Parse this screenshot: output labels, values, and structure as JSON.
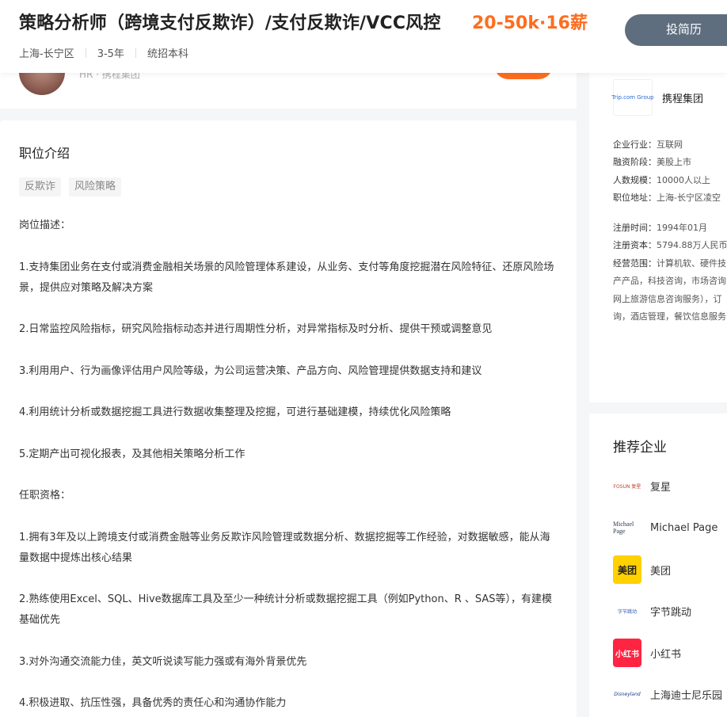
{
  "header": {
    "job_title": "策略分析师（跨境支付反欺诈）/支付反欺诈/VCC风控",
    "salary": "20-50k·16薪",
    "location": "上海-长宁区",
    "experience": "3-5年",
    "education": "统招本科",
    "apply_label": "投简历"
  },
  "recruiter": {
    "text": "HR · 携程集团"
  },
  "job": {
    "section_title": "职位介绍",
    "tags": [
      "反欺诈",
      "风险策略"
    ],
    "description": [
      "岗位描述：",
      "1.支持集团业务在支付或消费金融相关场景的风险管理体系建设，从业务、支付等角度挖掘潜在风险特征、还原风险场景，提供应对策略及解决方案",
      "2.日常监控风险指标，研究风险指标动态并进行周期性分析，对异常指标及时分析、提供干预或调整意见",
      "3.利用用户、行为画像评估用户风险等级，为公司运营决策、产品方向、风险管理提供数据支持和建议",
      "4.利用统计分析或数据挖掘工具进行数据收集整理及挖掘，可进行基础建模，持续优化风险策略",
      "5.定期产出可视化报表，及其他相关策略分析工作",
      "任职资格：",
      "1.拥有3年及以上跨境支付或消费金融等业务反欺诈风险管理或数据分析、数据挖掘等工作经验，对数据敏感，能从海量数据中提炼出核心结果",
      "2.熟练使用Excel、SQL、Hive数据库工具及至少一种统计分析或数据挖掘工具（例如Python、R 、SAS等），有建模基础优先",
      "3.对外沟通交流能力佳，英文听说读写能力强或有海外背景优先",
      "4.积极进取、抗压性强，具备优秀的责任心和沟通协作能力"
    ]
  },
  "company": {
    "logo_text": "Trip.com Group",
    "name": "携程集团",
    "industry_label": "企业行业：",
    "industry": "互联网",
    "stage_label": "融资阶段：",
    "stage": "美股上市",
    "size_label": "人数规模：",
    "size": "10000人以上",
    "address_label": "职位地址：",
    "address": "上海-长宁区凌空",
    "reg_time_label": "注册时间：",
    "reg_time": "1994年01月",
    "capital_label": "注册资本：",
    "capital": "5794.88万人民币",
    "scope_label": "经营范围：",
    "scope_lines": [
      "计算机软、硬件技",
      "产产品，科技咨询，市场咨询",
      "网上旅游信息咨询服务），订",
      "询，酒店管理，餐饮信息服务"
    ]
  },
  "recommend": {
    "title": "推荐企业",
    "items": [
      {
        "name": "复星",
        "logo_text": "FOSUN 复星",
        "logo_color": "#b8432f",
        "logo_bg": "#ffffff"
      },
      {
        "name": "Michael Page",
        "logo_text": "Michael Page",
        "logo_color": "#2b3a55",
        "logo_bg": "#ffffff"
      },
      {
        "name": "美团",
        "logo_text": "美团",
        "logo_color": "#222222",
        "logo_bg": "#ffd100"
      },
      {
        "name": "字节跳动",
        "logo_text": "字节跳动",
        "logo_color": "#325ab4",
        "logo_bg": "#ffffff"
      },
      {
        "name": "小红书",
        "logo_text": "小红书",
        "logo_color": "#ffffff",
        "logo_bg": "#ff2442"
      },
      {
        "name": "上海迪士尼乐园",
        "logo_text": "Disneyland",
        "logo_color": "#1d3c8f",
        "logo_bg": "#ffffff"
      }
    ]
  },
  "colors": {
    "salary": "#fe6d1e",
    "apply_button": "#5f6e7f",
    "accent_orange": "#fe6d1e"
  }
}
